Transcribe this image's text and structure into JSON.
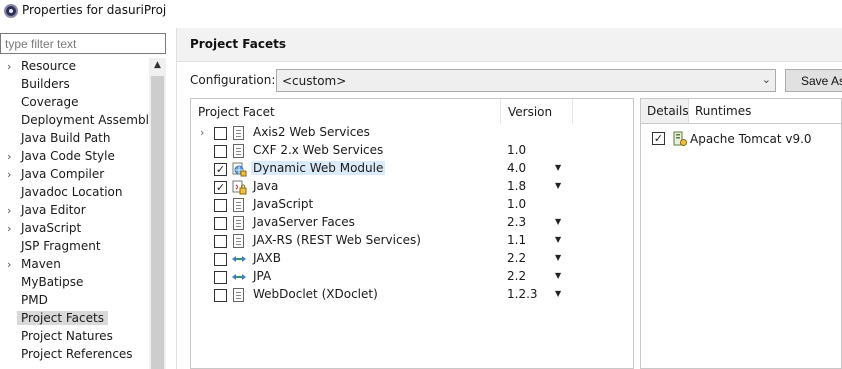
{
  "window": {
    "title": "Properties for dasuriProj"
  },
  "filter": {
    "placeholder": "type filter text"
  },
  "nav": {
    "items": [
      {
        "label": "Resource",
        "expandable": true
      },
      {
        "label": "Builders",
        "expandable": false
      },
      {
        "label": "Coverage",
        "expandable": false
      },
      {
        "label": "Deployment Assembly",
        "expandable": false
      },
      {
        "label": "Java Build Path",
        "expandable": false
      },
      {
        "label": "Java Code Style",
        "expandable": true
      },
      {
        "label": "Java Compiler",
        "expandable": true
      },
      {
        "label": "Javadoc Location",
        "expandable": false
      },
      {
        "label": "Java Editor",
        "expandable": true
      },
      {
        "label": "JavaScript",
        "expandable": true
      },
      {
        "label": "JSP Fragment",
        "expandable": false
      },
      {
        "label": "Maven",
        "expandable": true
      },
      {
        "label": "MyBatipse",
        "expandable": false
      },
      {
        "label": "PMD",
        "expandable": false
      },
      {
        "label": "Project Facets",
        "expandable": false,
        "selected": true
      },
      {
        "label": "Project Natures",
        "expandable": false
      },
      {
        "label": "Project References",
        "expandable": false
      }
    ]
  },
  "page": {
    "title": "Project Facets"
  },
  "configuration": {
    "label": "Configuration:",
    "value": "<custom>",
    "save_label": "Save As"
  },
  "facets": {
    "headers": {
      "facet": "Project Facet",
      "version": "Version"
    },
    "rows": [
      {
        "name": "Axis2 Web Services",
        "version": "",
        "checked": false,
        "expandable": true,
        "icon": "document-icon",
        "dropdown": false
      },
      {
        "name": "CXF 2.x Web Services",
        "version": "1.0",
        "checked": false,
        "expandable": false,
        "icon": "document-icon",
        "dropdown": false
      },
      {
        "name": "Dynamic Web Module",
        "version": "4.0",
        "checked": true,
        "expandable": false,
        "icon": "web-module-icon",
        "dropdown": true,
        "highlight": true
      },
      {
        "name": "Java",
        "version": "1.8",
        "checked": true,
        "expandable": false,
        "icon": "java-lock-icon",
        "dropdown": true
      },
      {
        "name": "JavaScript",
        "version": "1.0",
        "checked": false,
        "expandable": false,
        "icon": "document-icon",
        "dropdown": false
      },
      {
        "name": "JavaServer Faces",
        "version": "2.3",
        "checked": false,
        "expandable": false,
        "icon": "document-icon",
        "dropdown": true
      },
      {
        "name": "JAX-RS (REST Web Services)",
        "version": "1.1",
        "checked": false,
        "expandable": false,
        "icon": "document-icon",
        "dropdown": true
      },
      {
        "name": "JAXB",
        "version": "2.2",
        "checked": false,
        "expandable": false,
        "icon": "arrows-icon",
        "dropdown": true
      },
      {
        "name": "JPA",
        "version": "2.2",
        "checked": false,
        "expandable": false,
        "icon": "arrows-icon",
        "dropdown": true
      },
      {
        "name": "WebDoclet (XDoclet)",
        "version": "1.2.3",
        "checked": false,
        "expandable": false,
        "icon": "document-icon",
        "dropdown": true
      }
    ]
  },
  "side_tabs": {
    "details_label": "Details",
    "runtimes_label": "Runtimes",
    "runtimes": [
      {
        "name": "Apache Tomcat v9.0",
        "checked": true
      }
    ]
  },
  "colors": {
    "selection": "#d9d9d9",
    "highlight": "#dcebfc",
    "header_bg": "#f2f2f2"
  }
}
